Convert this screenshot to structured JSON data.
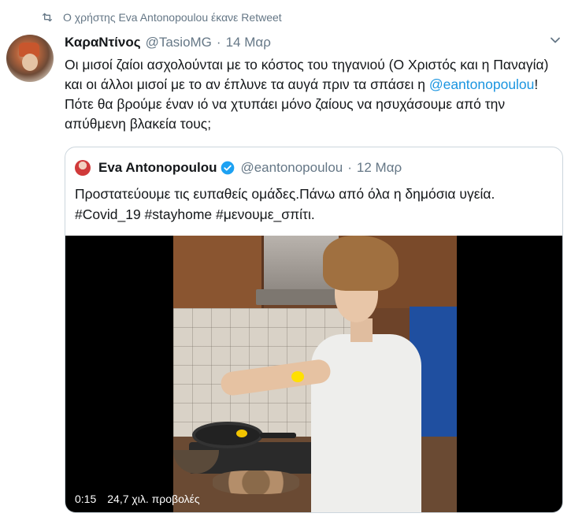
{
  "retweet": {
    "icon": "retweet-icon",
    "text": "Ο χρήστης Eva Antonopoulou έκανε Retweet"
  },
  "tweet": {
    "author_name": "ΚαραΝτίνος",
    "author_handle": "@TasioMG",
    "separator": "·",
    "date": "14 Μαρ",
    "text_part1": "Οι μισοί ζαίοι ασχολούνται με το κόστος του τηγανιού (Ο Χριστός και η Παναγία) και οι άλλοι μισοί με το αν έπλυνε τα αυγά πριν τα σπάσει η ",
    "mention": "@eantonopoulou",
    "text_part2": "! Πότε θα βρούμε έναν ιό να χτυπάει μόνο ζαίους να ησυχάσουμε από την απύθμενη βλακεία τους;"
  },
  "quoted": {
    "author_name": "Eva Antonopoulou",
    "verified": true,
    "author_handle": "@eantonopoulou",
    "separator": "·",
    "date": "12 Μαρ",
    "text": "Προστατεύουμε τις ευπαθείς ομάδες.Πάνω από όλα η δημόσια υγεία. #Covid_19 #stayhome #μενουμε_σπίτι.",
    "video": {
      "time": "0:15",
      "views": "24,7 χιλ. προβολές"
    }
  },
  "colors": {
    "link": "#1b95e0",
    "secondary_text": "#657786",
    "border": "#ccd6dd",
    "verified": "#1da1f2"
  }
}
